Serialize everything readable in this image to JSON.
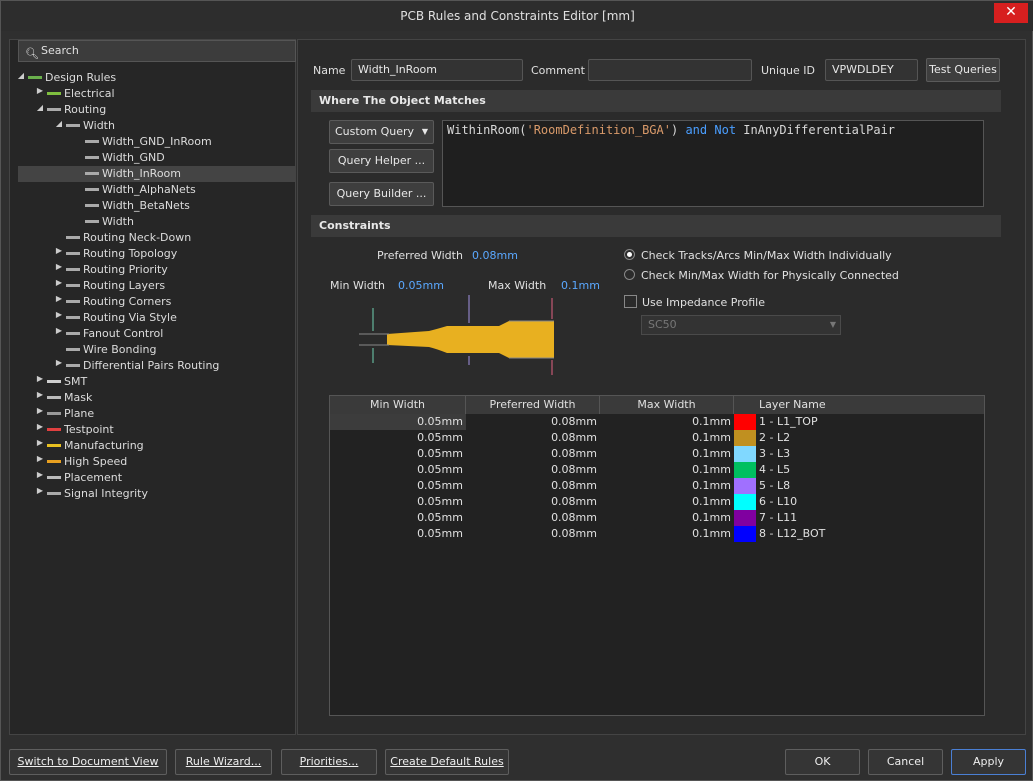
{
  "window": {
    "title": "PCB Rules and Constraints Editor [mm]",
    "close_label": "✕"
  },
  "search": {
    "placeholder": "Search"
  },
  "tree": [
    {
      "label": "Design Rules",
      "level": 0,
      "expanded": true,
      "icon": "design-rules-icon"
    },
    {
      "label": "Electrical",
      "level": 1,
      "expanded": false,
      "icon": "electrical-icon"
    },
    {
      "label": "Routing",
      "level": 1,
      "expanded": true,
      "icon": "routing-icon"
    },
    {
      "label": "Width",
      "level": 2,
      "expanded": true,
      "icon": "rule-icon"
    },
    {
      "label": "Width_GND_InRoom",
      "level": 3,
      "icon": "rule-icon"
    },
    {
      "label": "Width_GND",
      "level": 3,
      "icon": "rule-icon"
    },
    {
      "label": "Width_InRoom",
      "level": 3,
      "icon": "rule-icon",
      "selected": true
    },
    {
      "label": "Width_AlphaNets",
      "level": 3,
      "icon": "rule-icon"
    },
    {
      "label": "Width_BetaNets",
      "level": 3,
      "icon": "rule-icon"
    },
    {
      "label": "Width",
      "level": 3,
      "icon": "rule-icon"
    },
    {
      "label": "Routing Neck-Down",
      "level": 2,
      "icon": "rule-icon"
    },
    {
      "label": "Routing Topology",
      "level": 2,
      "expanded": false,
      "icon": "rule-icon"
    },
    {
      "label": "Routing Priority",
      "level": 2,
      "expanded": false,
      "icon": "rule-icon"
    },
    {
      "label": "Routing Layers",
      "level": 2,
      "expanded": false,
      "icon": "rule-icon"
    },
    {
      "label": "Routing Corners",
      "level": 2,
      "expanded": false,
      "icon": "rule-icon"
    },
    {
      "label": "Routing Via Style",
      "level": 2,
      "expanded": false,
      "icon": "rule-icon"
    },
    {
      "label": "Fanout Control",
      "level": 2,
      "expanded": false,
      "icon": "rule-icon"
    },
    {
      "label": "Wire Bonding",
      "level": 2,
      "icon": "rule-icon"
    },
    {
      "label": "Differential Pairs Routing",
      "level": 2,
      "expanded": false,
      "icon": "rule-icon"
    },
    {
      "label": "SMT",
      "level": 1,
      "expanded": false,
      "icon": "smt-icon"
    },
    {
      "label": "Mask",
      "level": 1,
      "expanded": false,
      "icon": "mask-icon"
    },
    {
      "label": "Plane",
      "level": 1,
      "expanded": false,
      "icon": "plane-icon"
    },
    {
      "label": "Testpoint",
      "level": 1,
      "expanded": false,
      "icon": "testpoint-icon"
    },
    {
      "label": "Manufacturing",
      "level": 1,
      "expanded": false,
      "icon": "manufacturing-icon"
    },
    {
      "label": "High Speed",
      "level": 1,
      "expanded": false,
      "icon": "high-speed-icon"
    },
    {
      "label": "Placement",
      "level": 1,
      "expanded": false,
      "icon": "placement-icon"
    },
    {
      "label": "Signal Integrity",
      "level": 1,
      "expanded": false,
      "icon": "signal-integrity-icon"
    }
  ],
  "rule": {
    "name_label": "Name",
    "name": "Width_InRoom",
    "comment_label": "Comment",
    "comment": "",
    "uid_label": "Unique ID",
    "uid": "VPWDLDEY",
    "test_queries": "Test Queries"
  },
  "where": {
    "header": "Where The Object Matches",
    "query_type": "Custom Query",
    "query_helper": "Query Helper ...",
    "query_builder": "Query Builder ...",
    "query": {
      "fn1": "WithinRoom(",
      "arg": "'RoomDefinition_BGA'",
      "close": ")",
      "and": "and",
      "not": "Not",
      "fn2": "InAnyDifferentialPair"
    }
  },
  "constraints": {
    "header": "Constraints",
    "preferred_label": "Preferred Width",
    "preferred": "0.08mm",
    "min_label": "Min Width",
    "min": "0.05mm",
    "max_label": "Max Width",
    "max": "0.1mm",
    "radio1": "Check Tracks/Arcs Min/Max Width Individually",
    "radio2": "Check Min/Max Width for Physically Connected",
    "impedance": "Use Impedance Profile",
    "profile": "SC50",
    "track_color": "#e8b020"
  },
  "table": {
    "headers": [
      "Min Width",
      "Preferred Width",
      "Max Width",
      "Layer Name"
    ],
    "rows": [
      {
        "min": "0.05mm",
        "pref": "0.08mm",
        "max": "0.1mm",
        "layer": "1 - L1_TOP",
        "color": "#ff0000"
      },
      {
        "min": "0.05mm",
        "pref": "0.08mm",
        "max": "0.1mm",
        "layer": "2 - L2",
        "color": "#c09020"
      },
      {
        "min": "0.05mm",
        "pref": "0.08mm",
        "max": "0.1mm",
        "layer": "3 - L3",
        "color": "#80d8ff"
      },
      {
        "min": "0.05mm",
        "pref": "0.08mm",
        "max": "0.1mm",
        "layer": "4 - L5",
        "color": "#00c060"
      },
      {
        "min": "0.05mm",
        "pref": "0.08mm",
        "max": "0.1mm",
        "layer": "5 - L8",
        "color": "#a070ff"
      },
      {
        "min": "0.05mm",
        "pref": "0.08mm",
        "max": "0.1mm",
        "layer": "6 - L10",
        "color": "#00ffff"
      },
      {
        "min": "0.05mm",
        "pref": "0.08mm",
        "max": "0.1mm",
        "layer": "7 - L11",
        "color": "#8000a0"
      },
      {
        "min": "0.05mm",
        "pref": "0.08mm",
        "max": "0.1mm",
        "layer": "8 - L12_BOT",
        "color": "#0000ff"
      }
    ]
  },
  "footer": {
    "switch": "Switch to Document View",
    "wizard": "Rule Wizard...",
    "priorities": "Priorities...",
    "defaults": "Create Default Rules",
    "ok": "OK",
    "cancel": "Cancel",
    "apply": "Apply"
  }
}
